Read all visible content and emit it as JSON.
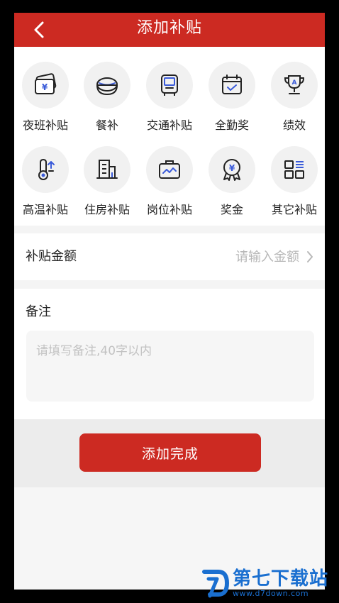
{
  "header": {
    "title": "添加补贴"
  },
  "categories": [
    {
      "label": "夜班补贴",
      "icon": "night-shift-ticket-icon"
    },
    {
      "label": "餐补",
      "icon": "meal-bowl-icon"
    },
    {
      "label": "交通补贴",
      "icon": "bus-icon"
    },
    {
      "label": "全勤奖",
      "icon": "calendar-check-icon"
    },
    {
      "label": "绩效",
      "icon": "trophy-icon"
    },
    {
      "label": "高温补贴",
      "icon": "thermometer-icon"
    },
    {
      "label": "住房补贴",
      "icon": "building-icon"
    },
    {
      "label": "岗位补贴",
      "icon": "briefcase-icon"
    },
    {
      "label": "奖金",
      "icon": "medal-icon"
    },
    {
      "label": "其它补贴",
      "icon": "grid-list-icon"
    }
  ],
  "amount": {
    "label": "补贴金额",
    "placeholder": "请输入金额"
  },
  "remark": {
    "label": "备注",
    "placeholder": "请填写备注,40字以内"
  },
  "submit": {
    "label": "添加完成"
  },
  "watermark": {
    "main": "第七下载站",
    "sub": "www.d7down.com"
  },
  "colors": {
    "brand": "#cc2a22",
    "icon_stroke": "#222222",
    "icon_accent": "#3a5bd9",
    "watermark": "#1a6fd0"
  }
}
